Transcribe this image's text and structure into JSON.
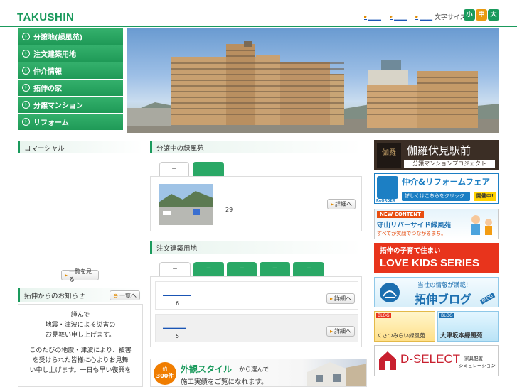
{
  "header": {
    "logo": "TAKUSHIN",
    "links": [
      "＿＿",
      "＿＿",
      "＿＿"
    ],
    "font_size_label": "文字サイズ",
    "font_sizes": [
      {
        "label": "小",
        "color": "#1a9a5c"
      },
      {
        "label": "中",
        "color": "#e89a10"
      },
      {
        "label": "大",
        "color": "#1a9a5c"
      }
    ]
  },
  "nav": {
    "items": [
      {
        "label": "分譲地(緑風苑)"
      },
      {
        "label": "注文建築用地"
      },
      {
        "label": "仲介情報"
      },
      {
        "label": "拓伸の家"
      },
      {
        "label": "分譲マンション"
      },
      {
        "label": "リフォーム"
      }
    ]
  },
  "left": {
    "commercial_heading": "コマーシャル",
    "list_button": "一覧を見る",
    "news_heading": "拓伸からのお知らせ",
    "news_list_button": "一覧へ",
    "notice_lines": [
      "謹んで",
      "地震・津波による災害の",
      "お見舞い申し上げます。",
      "",
      "このたびの地震・津波により、被害",
      "を受けられた皆様に心よりお見舞",
      "い申し上げます。一日も早い復興を"
    ]
  },
  "middle": {
    "section1_heading": "分譲中の緑風苑",
    "section1_tabs": [
      "－",
      ""
    ],
    "section1_item": {
      "number": "29",
      "detail_button": "詳細へ"
    },
    "section2_heading": "注文建築用地",
    "section2_tabs": [
      "－",
      "－",
      "－",
      "－",
      "－"
    ],
    "section2_items": [
      {
        "link": "＿＿＿＿＿",
        "number": "6",
        "detail_button": "詳細へ"
      },
      {
        "link": "＿＿＿＿",
        "number": "5",
        "detail_button": "詳細へ"
      }
    ],
    "bottom_banner": {
      "badge_top": "約",
      "badge_num": "300件",
      "main": "外観スタイル",
      "suffix": "から選んで",
      "sub": "施工実績をご覧になれます。"
    }
  },
  "banners": {
    "fushimi": {
      "logo": "伽羅",
      "title": "伽羅伏見駅前",
      "sub": "分譲マンションプロジェクト"
    },
    "reorder": {
      "brand": "ReORDER",
      "title": "仲介&リフォームフェア",
      "cta": "詳しくはこちらをクリック",
      "badge": "開催中!"
    },
    "moriyama": {
      "tag": "NEW CONTENT",
      "title": "守山リバーサイド緑風苑",
      "sub": "すべてが笑顔でつながるまち。"
    },
    "lovekids": {
      "top": "拓伸の子育て住まい",
      "title": "LOVE KIDS SERIES"
    },
    "blog": {
      "top": "当社の情報が満載!",
      "title": "拓伸ブログ",
      "tag": "BLOG"
    },
    "blogs2": {
      "left": "くさつみらい緑風苑",
      "right": "大津坂本緑風苑",
      "tag": "BLOG"
    },
    "dselect": {
      "title": "D-SELECT",
      "sub1": "家具配置",
      "sub2": "シミュレーション"
    }
  }
}
